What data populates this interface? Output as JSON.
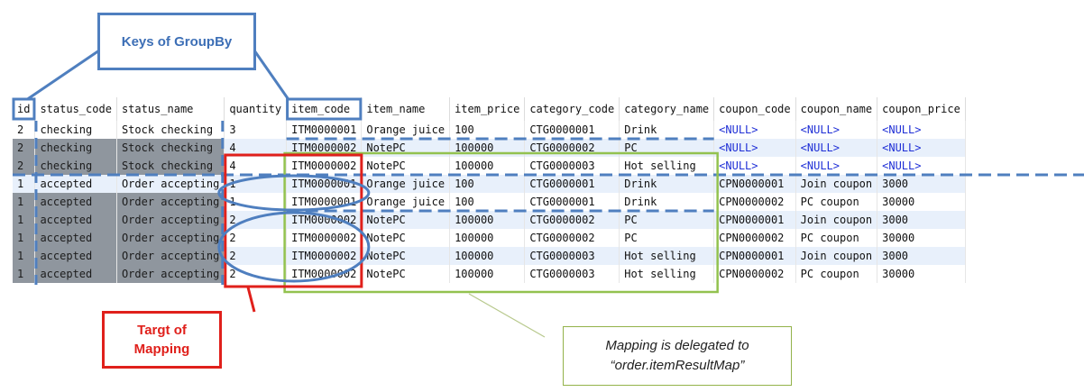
{
  "callouts": {
    "keys": "Keys of GroupBy",
    "target_line1": "Targt of",
    "target_line2": "Mapping",
    "delegate_line1": "Mapping is delegated to",
    "delegate_line2": "“order.itemResultMap”"
  },
  "table": {
    "columns": [
      "id",
      "status_code",
      "status_name",
      "quantity",
      "item_code",
      "item_name",
      "item_price",
      "category_code",
      "category_name",
      "coupon_code",
      "coupon_name",
      "coupon_price"
    ],
    "rows": [
      [
        "2",
        "checking",
        "Stock checking",
        "3",
        "ITM0000001",
        "Orange juice",
        "100",
        "CTG0000001",
        "Drink",
        "<NULL>",
        "<NULL>",
        "<NULL>"
      ],
      [
        "2",
        "checking",
        "Stock checking",
        "4",
        "ITM0000002",
        "NotePC",
        "100000",
        "CTG0000002",
        "PC",
        "<NULL>",
        "<NULL>",
        "<NULL>"
      ],
      [
        "2",
        "checking",
        "Stock checking",
        "4",
        "ITM0000002",
        "NotePC",
        "100000",
        "CTG0000003",
        "Hot selling",
        "<NULL>",
        "<NULL>",
        "<NULL>"
      ],
      [
        "1",
        "accepted",
        "Order accepting",
        "1",
        "ITM0000001",
        "Orange juice",
        "100",
        "CTG0000001",
        "Drink",
        "CPN0000001",
        "Join coupon",
        "3000"
      ],
      [
        "1",
        "accepted",
        "Order accepting",
        "1",
        "ITM0000001",
        "Orange juice",
        "100",
        "CTG0000001",
        "Drink",
        "CPN0000002",
        "PC coupon",
        "30000"
      ],
      [
        "1",
        "accepted",
        "Order accepting",
        "2",
        "ITM0000002",
        "NotePC",
        "100000",
        "CTG0000002",
        "PC",
        "CPN0000001",
        "Join coupon",
        "3000"
      ],
      [
        "1",
        "accepted",
        "Order accepting",
        "2",
        "ITM0000002",
        "NotePC",
        "100000",
        "CTG0000002",
        "PC",
        "CPN0000002",
        "PC coupon",
        "30000"
      ],
      [
        "1",
        "accepted",
        "Order accepting",
        "2",
        "ITM0000002",
        "NotePC",
        "100000",
        "CTG0000003",
        "Hot selling",
        "CPN0000001",
        "Join coupon",
        "3000"
      ],
      [
        "1",
        "accepted",
        "Order accepting",
        "2",
        "ITM0000002",
        "NotePC",
        "100000",
        "CTG0000003",
        "Hot selling",
        "CPN0000002",
        "PC coupon",
        "30000"
      ]
    ],
    "dimmed_rows": [
      1,
      2,
      4,
      5,
      6,
      7,
      8
    ],
    "null_color": "#1f2fd6"
  },
  "colors": {
    "key_blue": "#4f7fbf",
    "target_red": "#e0201b",
    "mapping_green": "#93c24f",
    "dim_gray": "#8f969e",
    "row_stripe": "#e8f0fb"
  }
}
